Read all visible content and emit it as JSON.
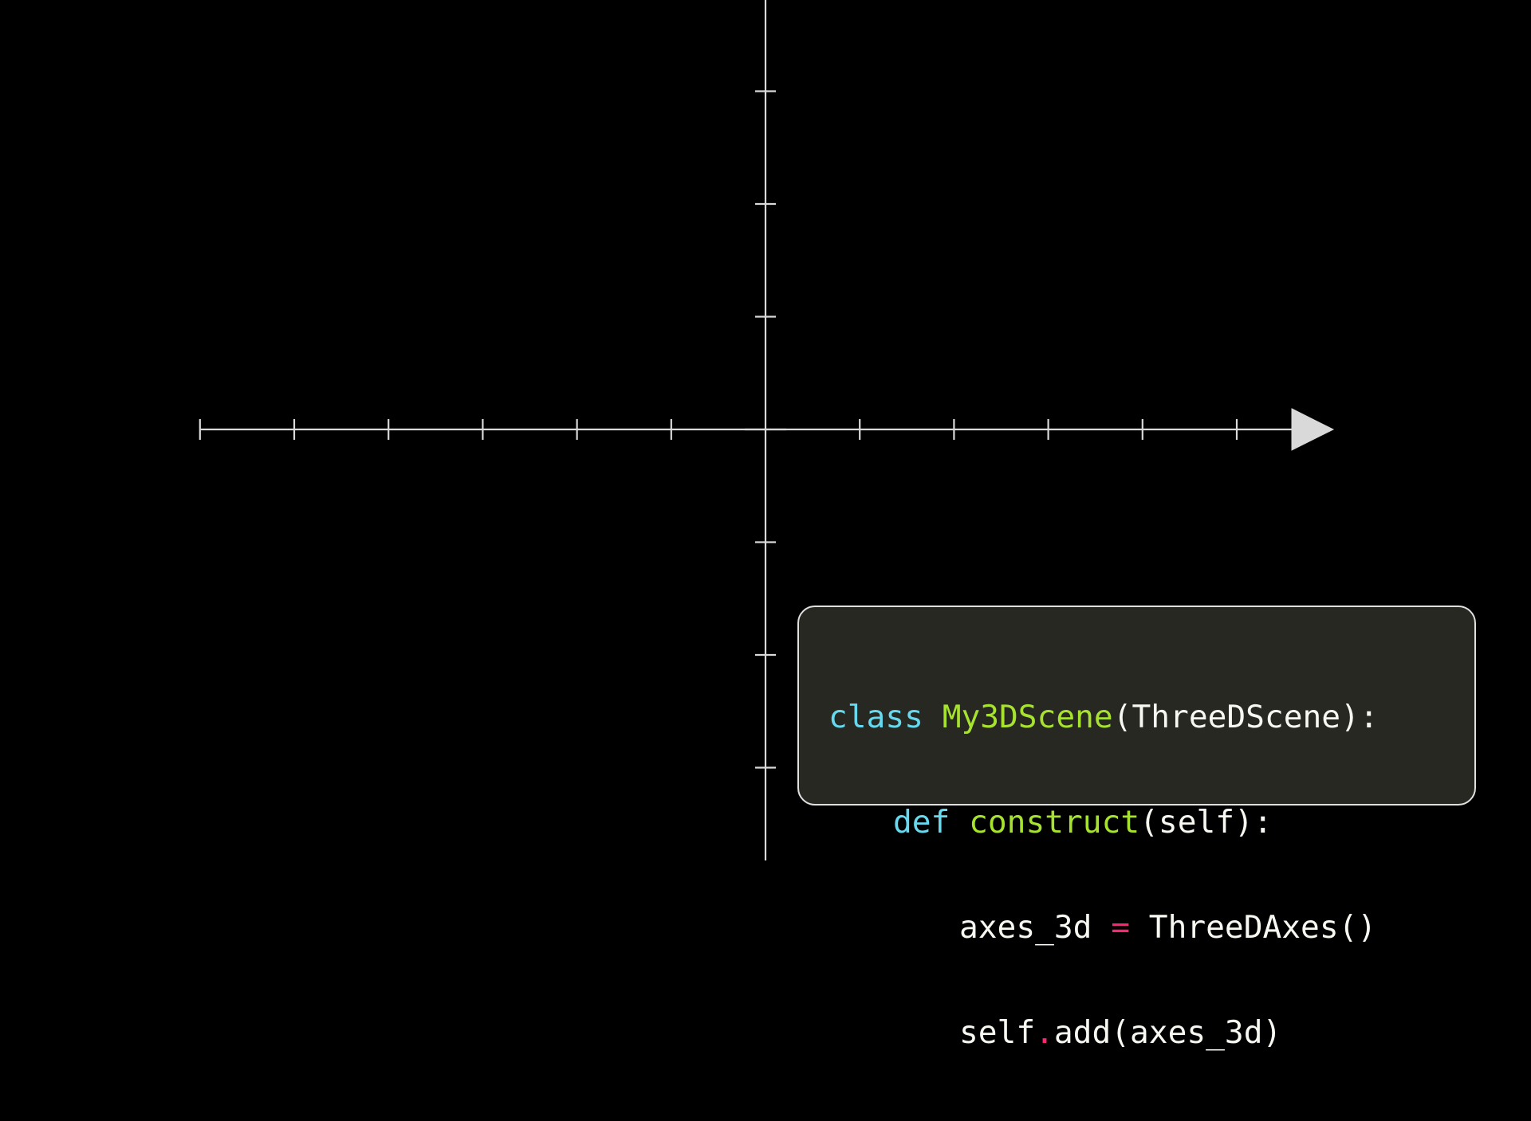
{
  "colors": {
    "background": "#000000",
    "axis": "#d9d9d9",
    "code_background": "#272822",
    "code_border": "#e0e0e0",
    "keyword": "#66d9ef",
    "name": "#a6e22e",
    "operator": "#f92672",
    "text": "#f8f8f2"
  },
  "axes": {
    "x_ticks": [
      -6,
      -5,
      -4,
      -3,
      -2,
      -1,
      1,
      2,
      3,
      4,
      5
    ],
    "y_ticks": [
      -3,
      -2,
      -1,
      1,
      2,
      3
    ],
    "x_range": [
      -6,
      6
    ],
    "y_range": [
      -3.8,
      3.8
    ],
    "arrow_on": "x-positive",
    "icons": [
      "x-axis-arrow-icon"
    ]
  },
  "code": {
    "line1": {
      "kw": "class",
      "sp": " ",
      "name": "My3DScene",
      "rest": "(ThreeDScene):"
    },
    "line2": {
      "kw": "def",
      "sp": " ",
      "name": "construct",
      "rest": "(self):"
    },
    "line3": {
      "a": "axes_3d ",
      "op": "=",
      "b": " ThreeDAxes()"
    },
    "line4": {
      "a": "self",
      "op": ".",
      "b": "add(axes_3d)"
    }
  }
}
